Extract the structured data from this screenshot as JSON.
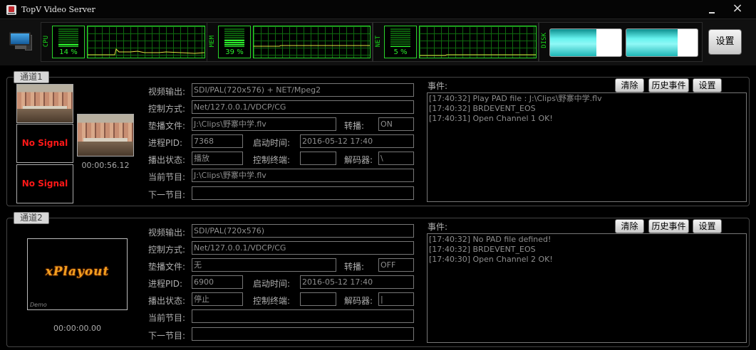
{
  "window": {
    "title": "TopV Video Server",
    "minimize": "_",
    "close": "×"
  },
  "monitors": {
    "cpu": {
      "label": "CPU",
      "percent_text": "14 %",
      "level": 0.14
    },
    "mem": {
      "label": "MEM",
      "percent_text": "39 %",
      "level": 0.39
    },
    "net": {
      "label": "NET",
      "percent_text": "5 %",
      "level": 0.05
    },
    "disk": {
      "label": "DISK",
      "levels": [
        0.65,
        0.72
      ]
    },
    "settings_label": "设置",
    "colors": {
      "meter_green": "#2cf02c",
      "graph_line": "#e0e040",
      "disk_cyan": "#67f3ef"
    }
  },
  "labels": {
    "video_out": "视频输出:",
    "control_mode": "控制方式:",
    "pad_file": "垫播文件:",
    "relay": "转播:",
    "pid": "进程PID:",
    "start_time": "启动时间:",
    "play_state": "播出状态:",
    "control_terminal": "控制终端:",
    "decoder": "解码器:",
    "current_program": "当前节目:",
    "next_program": "下一节目:",
    "events": "事件:",
    "clear": "清除",
    "history": "历史事件",
    "settings": "设置"
  },
  "channels": [
    {
      "tab": "通道1",
      "preview": {
        "small1": "",
        "nosignal": "No Signal",
        "timecode": "00:00:56.12"
      },
      "video_out": "SDI/PAL(720x576) + NET/Mpeg2",
      "control_mode": "Net/127.0.0.1/VDCP/CG",
      "pad_file": "J:\\Clips\\野寨中学.flv",
      "relay": "ON",
      "pid": "7368",
      "start_time": "2016-05-12 17:40",
      "play_state": "播放",
      "control_terminal": "",
      "decoder": "\\",
      "current_program": "J:\\Clips\\野寨中学.flv",
      "next_program": "",
      "events": [
        "[17:40:32] Play PAD file : J:\\Clips\\野寨中学.flv",
        "[17:40:32] BRDEVENT_EOS",
        "[17:40:31] Open Channel 1 OK!"
      ]
    },
    {
      "tab": "通道2",
      "preview": {
        "logo": "xPlayout",
        "demo": "Demo",
        "timecode": "00:00:00.00"
      },
      "video_out": "SDI/PAL(720x576)",
      "control_mode": "Net/127.0.0.1/VDCP/CG",
      "pad_file": "无",
      "relay": "OFF",
      "pid": "6900",
      "start_time": "2016-05-12 17:40",
      "play_state": "停止",
      "control_terminal": "",
      "decoder": "|",
      "current_program": "",
      "next_program": "",
      "events": [
        "[17:40:32] No PAD file defined!",
        "[17:40:32] BRDEVENT_EOS",
        "[17:40:30] Open Channel 2 OK!"
      ]
    }
  ]
}
